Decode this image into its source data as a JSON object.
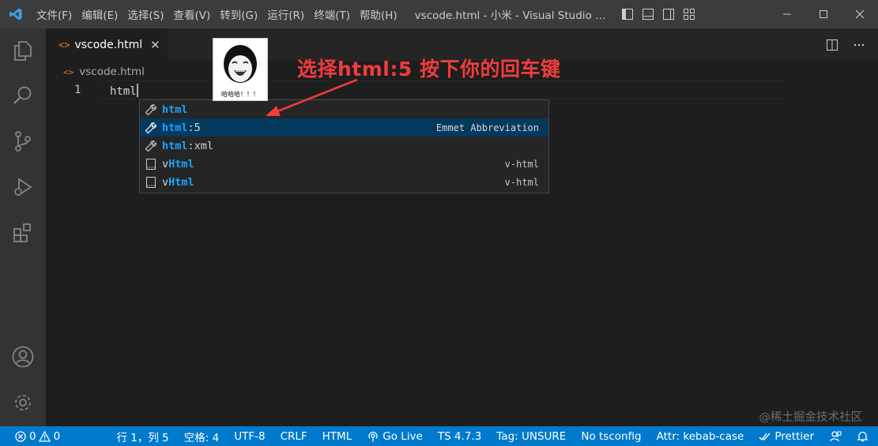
{
  "titlebar": {
    "menu": [
      "文件(F)",
      "编辑(E)",
      "选择(S)",
      "查看(V)",
      "转到(G)",
      "运行(R)",
      "终端(T)",
      "帮助(H)"
    ],
    "window_title": "vscode.html - 小米 - Visual Studio Code"
  },
  "tab": {
    "label": "vscode.html",
    "close": "✕"
  },
  "breadcrumb": {
    "file": "vscode.html"
  },
  "editor": {
    "line_number": "1",
    "code": "html"
  },
  "suggest": {
    "items": [
      {
        "prefix": "html",
        "suffix": "",
        "detail": ""
      },
      {
        "prefix": "html",
        "suffix": ":5",
        "detail": "Emmet Abbreviation"
      },
      {
        "prefix": "html",
        "suffix": ":xml",
        "detail": ""
      },
      {
        "pre": "v",
        "prefix": "Html",
        "suffix": "",
        "detail": "v-html"
      },
      {
        "pre": "v",
        "prefix": "Html",
        "suffix": "",
        "detail": "v-html"
      }
    ]
  },
  "annotation": {
    "text": "选择html:5 按下你的回车键",
    "meme_caption": "哈哈哈！！！"
  },
  "watermark": "@稀土掘金技术社区",
  "statusbar": {
    "errors": "0",
    "warnings": "0",
    "position": "行 1，列 5",
    "spaces": "空格: 4",
    "encoding": "UTF-8",
    "eol": "CRLF",
    "language": "HTML",
    "golive": "Go Live",
    "ts": "TS 4.7.3",
    "tag": "Tag: UNSURE",
    "tsconfig": "No tsconfig",
    "attr": "Attr: kebab-case",
    "prettier": "Prettier"
  },
  "colors": {
    "accent": "#007acc",
    "annotation": "#f03c3c",
    "highlight": "#18a3ff",
    "selected_row": "#04395e"
  }
}
